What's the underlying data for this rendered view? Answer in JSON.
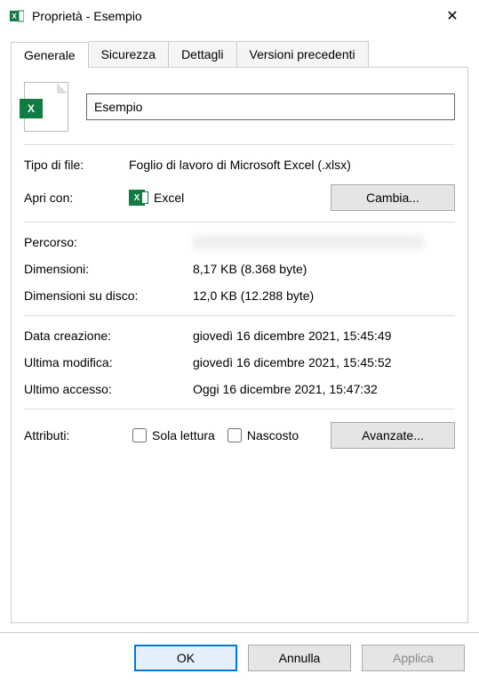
{
  "titlebar": {
    "title": "Proprietà - Esempio"
  },
  "tabs": {
    "general": "Generale",
    "security": "Sicurezza",
    "details": "Dettagli",
    "versions": "Versioni precedenti"
  },
  "general": {
    "filename": "Esempio",
    "filetype_label": "Tipo di file:",
    "filetype_value": "Foglio di lavoro di Microsoft Excel (.xlsx)",
    "openwith_label": "Apri con:",
    "openwith_app": "Excel",
    "change_btn": "Cambia...",
    "path_label": "Percorso:",
    "path_value": "",
    "size_label": "Dimensioni:",
    "size_value": "8,17 KB (8.368 byte)",
    "sizeondisk_label": "Dimensioni su disco:",
    "sizeondisk_value": "12,0 KB (12.288 byte)",
    "created_label": "Data creazione:",
    "created_value": "giovedì 16 dicembre 2021, 15:45:49",
    "modified_label": "Ultima modifica:",
    "modified_value": "giovedì 16 dicembre 2021, 15:45:52",
    "accessed_label": "Ultimo accesso:",
    "accessed_value": "Oggi 16 dicembre 2021, 15:47:32",
    "attributes_label": "Attributi:",
    "readonly_label": "Sola lettura",
    "hidden_label": "Nascosto",
    "advanced_btn": "Avanzate..."
  },
  "footer": {
    "ok": "OK",
    "cancel": "Annulla",
    "apply": "Applica"
  }
}
